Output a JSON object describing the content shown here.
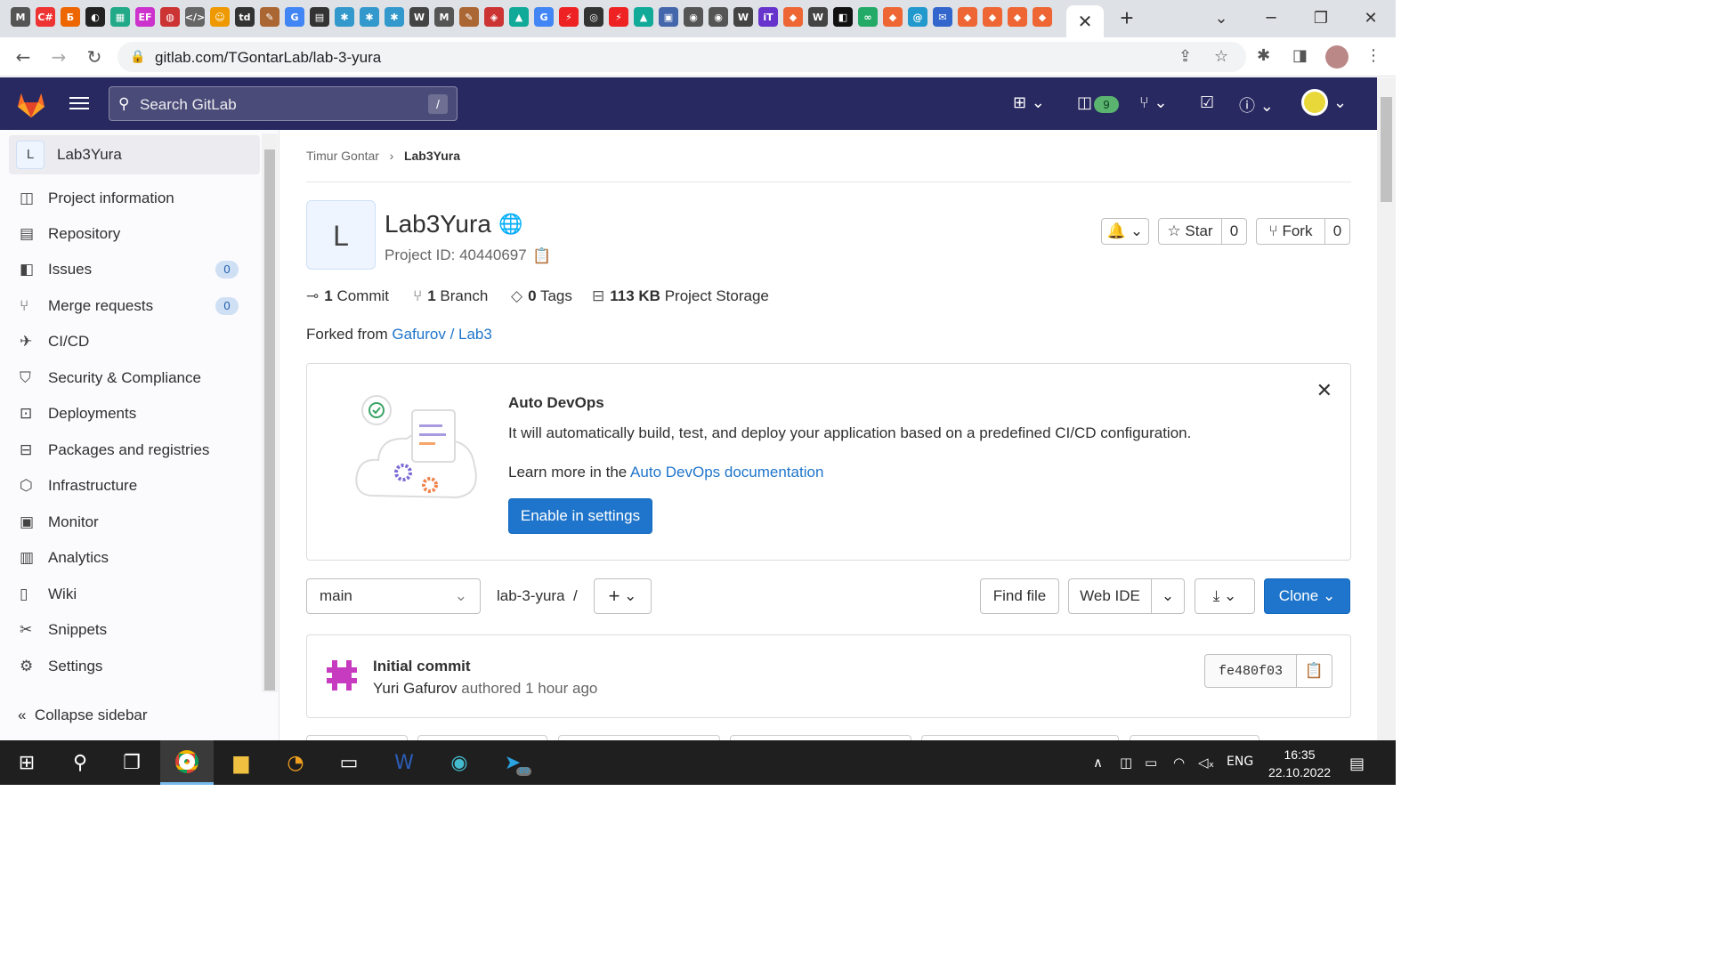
{
  "browser": {
    "url": "gitlab.com/TGontarLab/lab-3-yura",
    "tab_icons": [
      {
        "label": "M",
        "color": "#555"
      },
      {
        "label": "C#",
        "color": "#e33"
      },
      {
        "label": "Б",
        "color": "#e60"
      },
      {
        "label": "◐",
        "color": "#222"
      },
      {
        "label": "▦",
        "color": "#2a8"
      },
      {
        "label": "EF",
        "color": "#c3c"
      },
      {
        "label": "◍",
        "color": "#c33"
      },
      {
        "label": "</>",
        "color": "#666"
      },
      {
        "label": "☺",
        "color": "#e90"
      },
      {
        "label": "td",
        "color": "#333"
      },
      {
        "label": "✎",
        "color": "#a63"
      },
      {
        "label": "G",
        "color": "#4285f4"
      },
      {
        "label": "▤",
        "color": "#333"
      },
      {
        "label": "✱",
        "color": "#39c"
      },
      {
        "label": "✱",
        "color": "#39c"
      },
      {
        "label": "✱",
        "color": "#39c"
      },
      {
        "label": "W",
        "color": "#444"
      },
      {
        "label": "M",
        "color": "#555"
      },
      {
        "label": "✎",
        "color": "#a63"
      },
      {
        "label": "◈",
        "color": "#c33"
      },
      {
        "label": "▲",
        "color": "#1a9"
      },
      {
        "label": "G",
        "color": "#4285f4"
      },
      {
        "label": "⚡",
        "color": "#e22"
      },
      {
        "label": "◎",
        "color": "#333"
      },
      {
        "label": "⚡",
        "color": "#e22"
      },
      {
        "label": "▲",
        "color": "#1a9"
      },
      {
        "label": "▣",
        "color": "#46a"
      },
      {
        "label": "◉",
        "color": "#555"
      },
      {
        "label": "◉",
        "color": "#555"
      },
      {
        "label": "W",
        "color": "#444"
      },
      {
        "label": "iT",
        "color": "#63c"
      },
      {
        "label": "◆",
        "color": "#e63"
      },
      {
        "label": "W",
        "color": "#444"
      },
      {
        "label": "◧",
        "color": "#111"
      },
      {
        "label": "∞",
        "color": "#2a6"
      },
      {
        "label": "◆",
        "color": "#e63"
      },
      {
        "label": "@",
        "color": "#29c"
      },
      {
        "label": "✉",
        "color": "#36c"
      },
      {
        "label": "◆",
        "color": "#e63"
      },
      {
        "label": "◆",
        "color": "#e63"
      },
      {
        "label": "◆",
        "color": "#e63"
      },
      {
        "label": "◆",
        "color": "#e63"
      }
    ]
  },
  "gitlab_nav": {
    "search_placeholder": "Search GitLab",
    "search_shortcut": "/",
    "merge_requests_count": "9"
  },
  "sidebar": {
    "project_initial": "L",
    "project_name": "Lab3Yura",
    "items": [
      {
        "label": "Project information",
        "icon": "◫"
      },
      {
        "label": "Repository",
        "icon": "▤"
      },
      {
        "label": "Issues",
        "icon": "◧",
        "badge": "0"
      },
      {
        "label": "Merge requests",
        "icon": "⑂",
        "badge": "0"
      },
      {
        "label": "CI/CD",
        "icon": "✈"
      },
      {
        "label": "Security & Compliance",
        "icon": "⛉"
      },
      {
        "label": "Deployments",
        "icon": "⊡"
      },
      {
        "label": "Packages and registries",
        "icon": "⊟"
      },
      {
        "label": "Infrastructure",
        "icon": "⬡"
      },
      {
        "label": "Monitor",
        "icon": "▣"
      },
      {
        "label": "Analytics",
        "icon": "▥"
      },
      {
        "label": "Wiki",
        "icon": "▯"
      },
      {
        "label": "Snippets",
        "icon": "✂"
      },
      {
        "label": "Settings",
        "icon": "⚙"
      }
    ],
    "collapse_label": "Collapse sidebar"
  },
  "breadcrumb": {
    "owner": "Timur Gontar",
    "project": "Lab3Yura"
  },
  "project": {
    "initial": "L",
    "title": "Lab3Yura",
    "id_text": "Project ID: 40440697",
    "star_label": "Star",
    "star_count": "0",
    "fork_label": "Fork",
    "fork_count": "0",
    "stats": {
      "commits_count": "1",
      "commits_label": "Commit",
      "branches_count": "1",
      "branches_label": "Branch",
      "tags_count": "0",
      "tags_label": "Tags",
      "storage_size": "113 KB",
      "storage_label": "Project Storage"
    },
    "forked_prefix": "Forked from",
    "forked_from": "Gafurov / Lab3"
  },
  "auto_devops": {
    "title": "Auto DevOps",
    "description": "It will automatically build, test, and deploy your application based on a predefined CI/CD configuration.",
    "learn_prefix": "Learn more in the",
    "learn_link": "Auto DevOps documentation",
    "button": "Enable in settings"
  },
  "repo_toolbar": {
    "branch": "main",
    "path": "lab-3-yura",
    "path_sep": "/",
    "find_file": "Find file",
    "web_ide": "Web IDE",
    "clone": "Clone"
  },
  "last_commit": {
    "title": "Initial commit",
    "author": "Yuri Gafurov",
    "authored": "authored 1 hour ago",
    "sha": "fe480f03"
  },
  "taskbar": {
    "language": "ENG",
    "time": "16:35",
    "date": "22.10.2022",
    "telegram_badge": "89"
  }
}
